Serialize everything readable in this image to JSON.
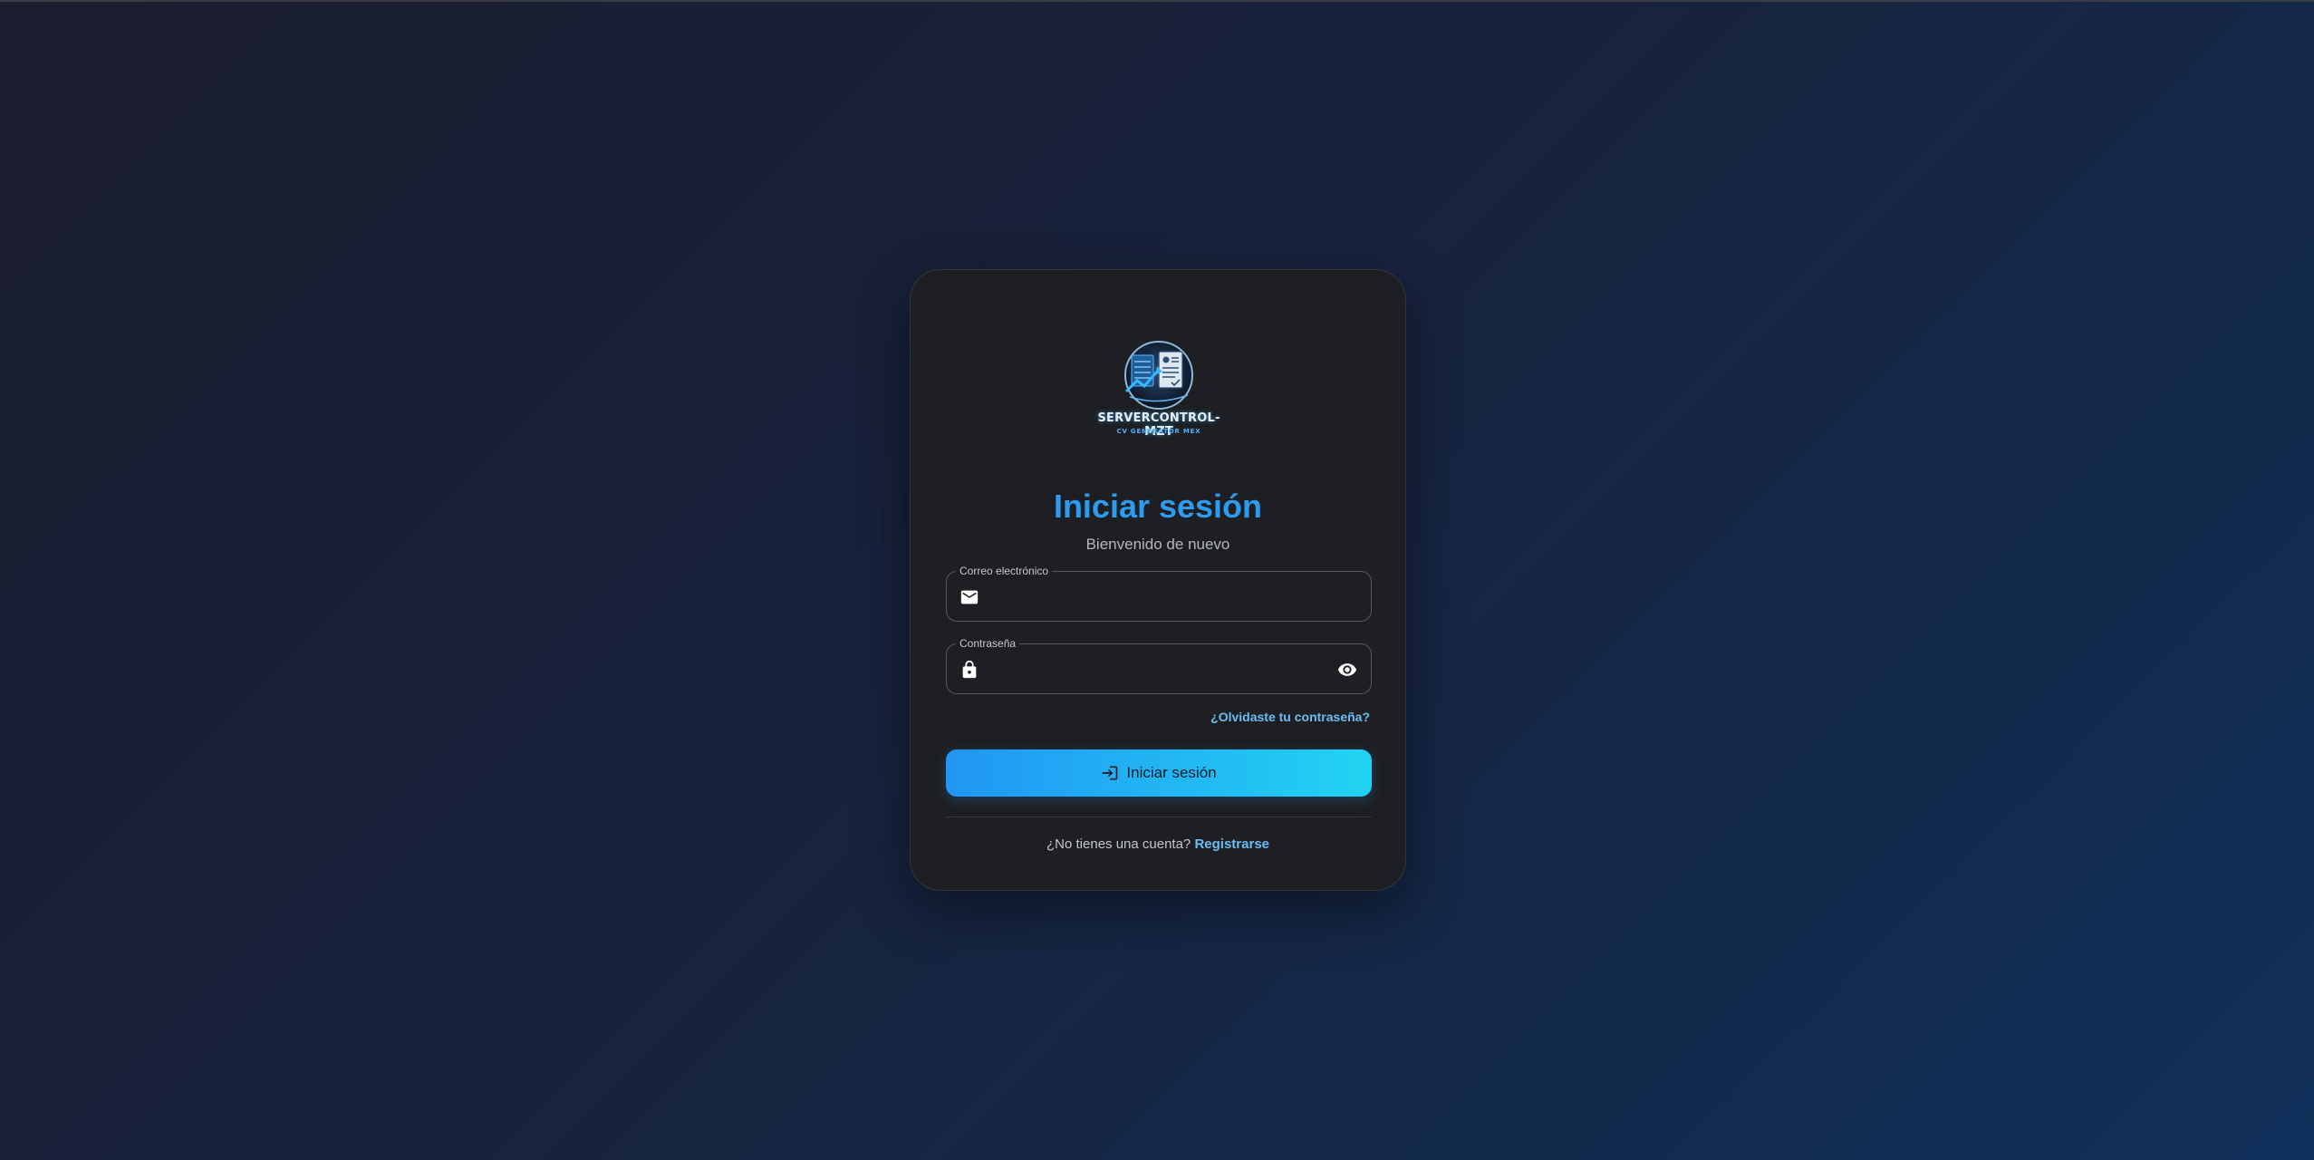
{
  "logo": {
    "brand_name": "SERVERCONTROL-MZT",
    "brand_sub": "CV GENERATOR MEX"
  },
  "login": {
    "title": "Iniciar sesión",
    "subtitle": "Bienvenido de nuevo",
    "email": {
      "label": "Correo electrónico",
      "value": "",
      "icon": "mail-icon"
    },
    "password": {
      "label": "Contraseña",
      "value": "",
      "icon": "lock-icon",
      "toggle_icon": "eye-icon"
    },
    "forgot_password": "¿Olvidaste tu contraseña?",
    "submit_label": "Iniciar sesión",
    "submit_icon": "login-icon",
    "no_account_text": "¿No tienes una cuenta?",
    "register_link": "Registrarse"
  },
  "colors": {
    "accent": "#2d9bf0",
    "button_gradient_start": "#2196f3",
    "button_gradient_end": "#22d3f2",
    "link": "#6cbcf5",
    "card_bg": "#1e1f22"
  }
}
